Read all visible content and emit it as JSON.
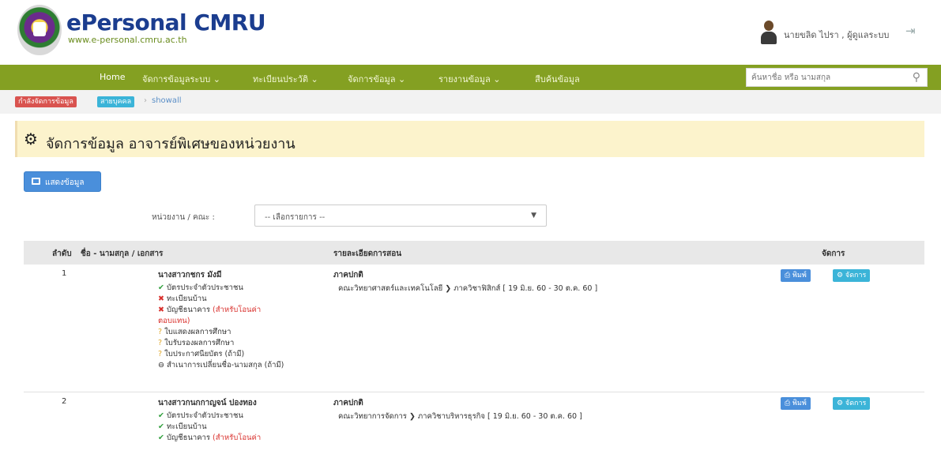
{
  "header": {
    "brand_title": "ePersonal CMRU",
    "brand_url": "www.e-personal.cmru.ac.th",
    "user_name": "นายขลิด ไปรา , ผู้ดูแลระบบ"
  },
  "navbar": {
    "items": [
      {
        "label": "Home"
      },
      {
        "label": "จัดการข้อมูลระบบ ⌄"
      },
      {
        "label": "ทะเบียนประวัติ ⌄"
      },
      {
        "label": "จัดการข้อมูล ⌄"
      },
      {
        "label": "รายงานข้อมูล ⌄"
      },
      {
        "label": "สืบค้นข้อมูล"
      }
    ],
    "search_placeholder": "ค้นหาชื่อ หรือ นามสกุล"
  },
  "breadcrumb": {
    "badge1": "กำลังจัดการข้อมูล",
    "badge2": "สายบุคคล",
    "separator": "›",
    "current": "showall"
  },
  "page": {
    "title": "จัดการข้อมูล อาจารย์พิเศษของหน่วยงาน",
    "show_button": "แสดงข้อมูล"
  },
  "filter": {
    "label": "หน่วยงาน / คณะ :",
    "selected": "-- เลือกรายการ --"
  },
  "table": {
    "headers": {
      "num": "ลำดับ",
      "name": "ชื่อ - นามสกุล / เอกสาร",
      "detail": "รายละเอียดการสอน",
      "action": "จัดการ"
    },
    "rows": [
      {
        "num": "1",
        "name": "นางสาวกชกร มังมี",
        "docs": [
          {
            "status": "ok",
            "text": "บัตรประจำตัวประชาชน",
            "note": ""
          },
          {
            "status": "no",
            "text": "ทะเบียนบ้าน",
            "note": ""
          },
          {
            "status": "no",
            "text": "บัญชีธนาคาร ",
            "note": "(สำหรับโอนค่า"
          },
          {
            "status": "none",
            "text": "",
            "note": "ตอบแทน)"
          },
          {
            "status": "q",
            "text": "ใบแสดงผลการศึกษา",
            "note": ""
          },
          {
            "status": "q",
            "text": "ใบรับรองผลการศึกษา",
            "note": ""
          },
          {
            "status": "q",
            "text": "ใบประกาศนียบัตร (ถ้ามี)",
            "note": ""
          },
          {
            "status": "dot",
            "text": "สำเนาการเปลี่ยนชื่อ-นามสกุล (ถ้ามี)",
            "note": ""
          }
        ],
        "detail_type": "ภาคปกติ",
        "detail_text": "คณะวิทยาศาสตร์และเทคโนโลยี ❯ ภาควิชาฟิสิกส์ [ 19 มิ.ย. 60 - 30 ต.ค. 60 ]",
        "print_label": "⎙ พิมพ์",
        "manage_label": "⚙ จัดการ"
      },
      {
        "num": "2",
        "name": "นางสาวกนกกาญจน์ ปองทอง",
        "docs": [
          {
            "status": "ok",
            "text": "บัตรประจำตัวประชาชน",
            "note": ""
          },
          {
            "status": "ok",
            "text": "ทะเบียนบ้าน",
            "note": ""
          },
          {
            "status": "ok",
            "text": "บัญชีธนาคาร ",
            "note": "(สำหรับโอนค่า"
          }
        ],
        "detail_type": "ภาคปกติ",
        "detail_text": "คณะวิทยาการจัดการ ❯ ภาควิชาบริหารธุรกิจ [ 19 มิ.ย. 60 - 30 ต.ค. 60 ]",
        "print_label": "⎙ พิมพ์",
        "manage_label": "⚙ จัดการ"
      }
    ]
  },
  "colors": {
    "navbar": "#84a022",
    "title_panel": "#fcf3cc",
    "primary_button": "#4a8fdb",
    "info_button": "#3bb4d8",
    "danger_badge": "#d9534f"
  }
}
